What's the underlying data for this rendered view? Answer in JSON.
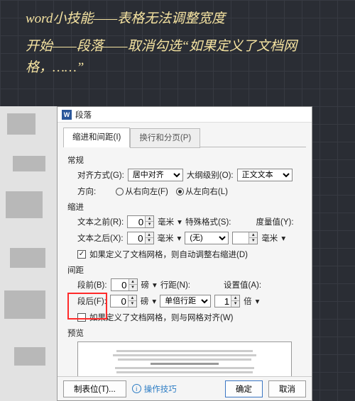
{
  "note": {
    "line1": "word小技能——表格无法调整宽度",
    "line2": "开始——段落——取消勾选“如果定义了文档网格，……”"
  },
  "dialog": {
    "title": "段落",
    "tabs": {
      "indent": "缩进和间距(I)",
      "page": "换行和分页(P)"
    },
    "general": {
      "title": "常规",
      "align_label": "对齐方式(G):",
      "align_value": "居中对齐",
      "outline_label": "大纲级别(O):",
      "outline_value": "正文文本",
      "direction_label": "方向:",
      "rtl": "从右向左(F)",
      "ltr": "从左向右(L)"
    },
    "indent": {
      "title": "缩进",
      "before_label": "文本之前(R):",
      "before_value": "0",
      "after_label": "文本之后(X):",
      "after_value": "0",
      "unit_char": "毫米",
      "special_label": "特殊格式(S):",
      "special_value": "(无)",
      "measure_label": "度量值(Y):",
      "measure_unit": "毫米",
      "auto_check": "如果定义了文档网格，则自动调整右缩进(D)"
    },
    "spacing": {
      "title": "间距",
      "before_label": "段前(B):",
      "before_value": "0",
      "after_label": "段后(F):",
      "after_value": "0",
      "unit": "磅",
      "line_label": "行距(N):",
      "line_value": "单倍行距",
      "at_label": "设置值(A):",
      "at_value": "1",
      "at_unit": "倍",
      "grid_check": "如果定义了文档网格，则与网格对齐(W)"
    },
    "preview_label": "预览",
    "buttons": {
      "tabstop": "制表位(T)...",
      "tips": "操作技巧",
      "ok": "确定",
      "cancel": "取消"
    }
  }
}
